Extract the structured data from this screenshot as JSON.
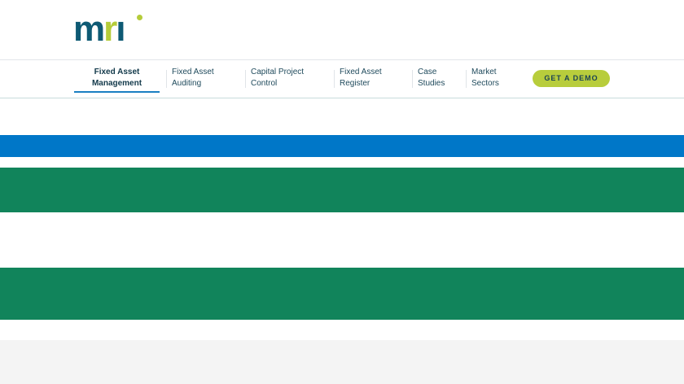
{
  "logo": {
    "text": "mri"
  },
  "nav": {
    "items": [
      {
        "label": "Fixed Asset Management"
      },
      {
        "label": "Fixed Asset Auditing"
      },
      {
        "label": "Capital Project Control"
      },
      {
        "label": "Fixed Asset Register"
      },
      {
        "label": "Case Studies"
      },
      {
        "label": "Market Sectors"
      }
    ],
    "demo_label": "GET A DEMO"
  },
  "colors": {
    "blue": "#0077c8",
    "green": "#11845b",
    "gray": "#f4f4f4",
    "lime": "#b8cd3c"
  }
}
